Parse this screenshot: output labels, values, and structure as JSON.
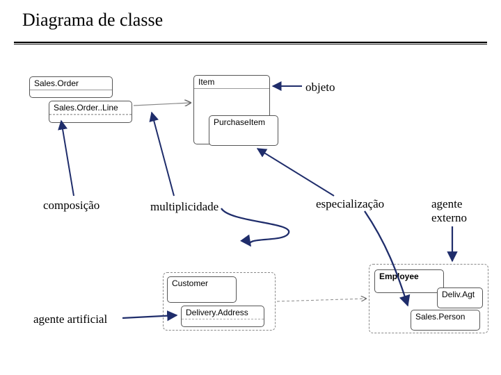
{
  "title": "Diagrama de classe",
  "annotations": {
    "objeto": "objeto",
    "composicao": "composição",
    "multiplicidade": "multiplicidade",
    "especializacao": "especialização",
    "agente_externo": "agente\nexterno",
    "agente_artificial": "agente artificial"
  },
  "classes": {
    "salesOrder": "Sales.Order",
    "salesOrderLine": "Sales.Order..Line",
    "item": "Item",
    "purchaseItem": "PurchaseItem",
    "customer": "Customer",
    "deliveryAddress": "Delivery.Address",
    "employee": "Employee",
    "delivAgt": "Deliv.Agt",
    "salesPerson": "Sales.Person"
  }
}
